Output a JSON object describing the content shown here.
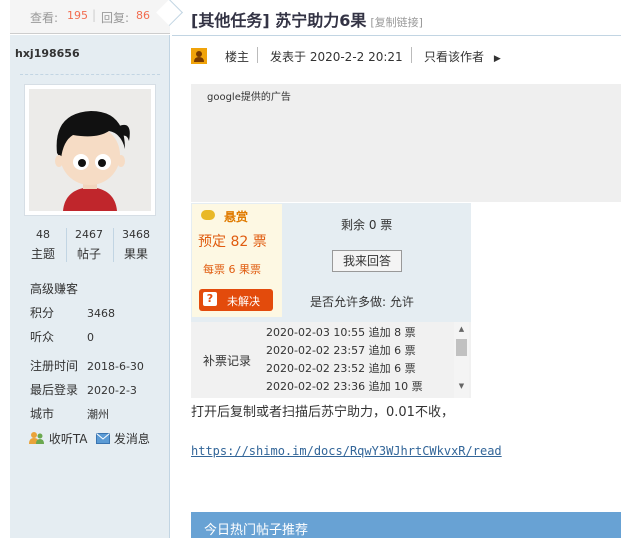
{
  "stats": {
    "views_label": "查看:",
    "views": "195",
    "separator": "|",
    "replies_label": "回复:",
    "replies": "86"
  },
  "user": {
    "name": "hxj198656",
    "stats": [
      {
        "value": "48",
        "label": "主题"
      },
      {
        "value": "2467",
        "label": "帖子"
      },
      {
        "value": "3468",
        "label": "果果"
      }
    ],
    "rank": "高级赚客",
    "info": [
      {
        "key": "积分",
        "value": "3468"
      },
      {
        "key": "听众",
        "value": "0"
      },
      {
        "key": "注册时间",
        "value": "2018-6-30"
      },
      {
        "key": "最后登录",
        "value": "2020-2-3"
      },
      {
        "key": "城市",
        "value": "潮州"
      }
    ],
    "follow_label": "收听TA",
    "message_label": "发消息"
  },
  "thread": {
    "title": "[其他任务] 苏宁助力6果",
    "copy_link": "[复制链接]"
  },
  "post": {
    "floor": "楼主",
    "posted": "发表于 2020-2-2 20:21",
    "only_author": "只看该作者"
  },
  "ad": {
    "text": "google提供的广告"
  },
  "bounty": {
    "label": "悬赏",
    "amount": "预定 82 票",
    "per_vote": "每票 6 果票",
    "unsolved": "未解决",
    "remaining": "剩余 0 票",
    "answer_button": "我来回答",
    "allow_multi": "是否允许多做: 允许",
    "records_label": "补票记录",
    "records": [
      "2020-02-03 10:55 追加 8 票",
      "2020-02-02 23:57 追加 6 票",
      "2020-02-02 23:52 追加 6 票",
      "2020-02-02 23:36 追加 10 票"
    ]
  },
  "content": {
    "text": "打开后复制或者扫描后苏宁助力，0.01不收，",
    "link": "https://shimo.im/docs/RqwY3WJhrtCWkvxR/read"
  },
  "hot": {
    "title": "今日热门帖子推荐"
  },
  "colors": {
    "accent_orange": "#f26c4f",
    "left_panel": "#e5edf2",
    "hot_bar": "#68a2d4",
    "link": "#336699"
  }
}
